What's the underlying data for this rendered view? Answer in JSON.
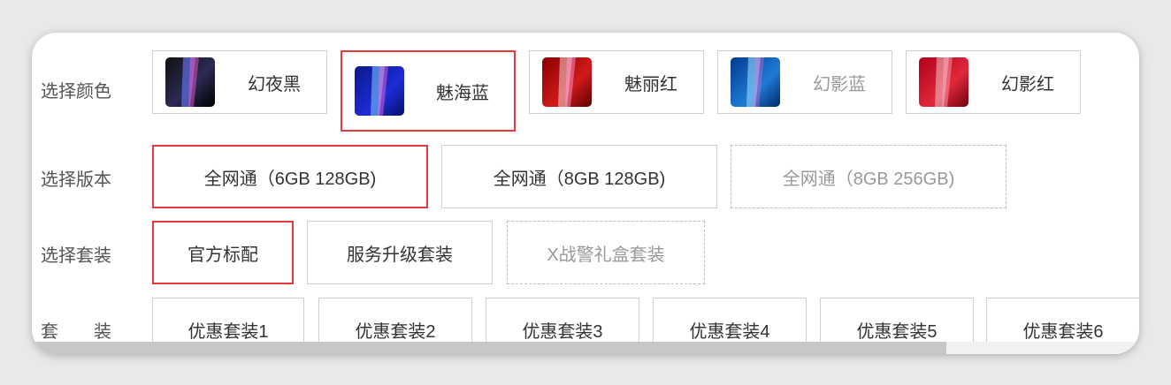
{
  "colors": {
    "label": "选择颜色",
    "options": [
      {
        "name": "幻夜黑",
        "state": "normal",
        "theme": "black"
      },
      {
        "name": "魅海蓝",
        "state": "selected",
        "theme": "navy"
      },
      {
        "name": "魅丽红",
        "state": "normal",
        "theme": "red"
      },
      {
        "name": "幻影蓝",
        "state": "normal",
        "theme": "blue"
      },
      {
        "name": "幻影红",
        "state": "normal",
        "theme": "crimson"
      }
    ]
  },
  "versions": {
    "label": "选择版本",
    "options": [
      {
        "name": "全网通（6GB 128GB)",
        "state": "selected"
      },
      {
        "name": "全网通（8GB 128GB)",
        "state": "normal"
      },
      {
        "name": "全网通（8GB 256GB)",
        "state": "disabled"
      }
    ]
  },
  "packages": {
    "label": "选择套装",
    "options": [
      {
        "name": "官方标配",
        "state": "selected"
      },
      {
        "name": "服务升级套装",
        "state": "normal"
      },
      {
        "name": "X战警礼盒套装",
        "state": "disabled"
      }
    ]
  },
  "bundles": {
    "label": "套　　装",
    "options": [
      {
        "name": "优惠套装1"
      },
      {
        "name": "优惠套装2"
      },
      {
        "name": "优惠套装3"
      },
      {
        "name": "优惠套装4"
      },
      {
        "name": "优惠套装5"
      },
      {
        "name": "优惠套装6"
      }
    ]
  },
  "style": {
    "accent": "#e4393c",
    "border": "#cfcfcf",
    "disabled_text": "#999999"
  }
}
